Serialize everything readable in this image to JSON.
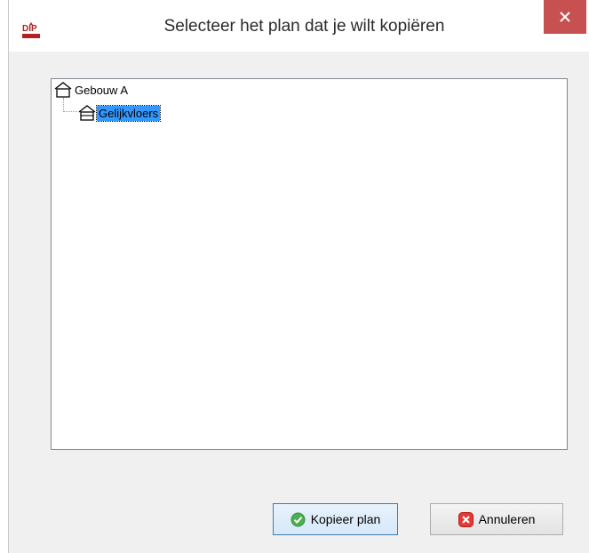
{
  "window": {
    "title": "Selecteer het plan dat je wilt kopiëren",
    "app_icon": "dip-app-icon",
    "app_icon_text": "DIP",
    "close_icon": "close-icon"
  },
  "tree": {
    "nodes": [
      {
        "label": "Gebouw A",
        "icon": "building-icon",
        "level": 0,
        "selected": false
      },
      {
        "label": "Gelijkvloers",
        "icon": "floor-plan-icon",
        "level": 1,
        "selected": true
      }
    ]
  },
  "buttons": {
    "copy": {
      "label": "Kopieer plan",
      "icon": "check-circle-icon"
    },
    "cancel": {
      "label": "Annuleren",
      "icon": "cancel-x-icon"
    }
  },
  "colors": {
    "close_bg": "#c75050",
    "selection": "#3399ff",
    "check_green": "#4caf50",
    "cancel_red": "#e53935"
  }
}
